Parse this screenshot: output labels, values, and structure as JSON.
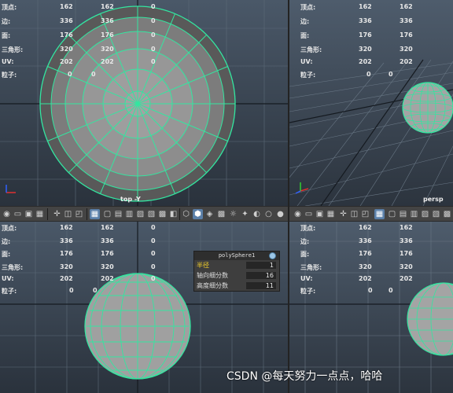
{
  "hud": {
    "rows": [
      {
        "label": "顶点:",
        "v1": "162",
        "v2": "162",
        "v3": "0"
      },
      {
        "label": "边:",
        "v1": "336",
        "v2": "336",
        "v3": "0"
      },
      {
        "label": "面:",
        "v1": "176",
        "v2": "176",
        "v3": "0"
      },
      {
        "label": "三角形:",
        "v1": "320",
        "v2": "320",
        "v3": "0"
      },
      {
        "label": "UV:",
        "v1": "202",
        "v2": "202",
        "v3": "0"
      },
      {
        "label": "粒子:",
        "v1": "0",
        "v2": "0",
        "v3": ""
      }
    ]
  },
  "viewports": {
    "top": {
      "camera": "top -Y"
    },
    "persp": {
      "camera": "persp"
    }
  },
  "poly_panel": {
    "title": "polySphere1",
    "rows": [
      {
        "label": "半径",
        "value": "1"
      },
      {
        "label": "轴向细分数",
        "value": "16"
      },
      {
        "label": "高度细分数",
        "value": "11"
      }
    ]
  },
  "watermark": "CSDN @每天努力一点点，哈哈",
  "colors": {
    "wireframe": "#33e6a0",
    "selected_label": "#f5d12a",
    "sphere_fill": "#a8a8a8",
    "highlight_icon": "#5a7fa8"
  },
  "toolbar_icons": [
    "camera-icon",
    "grid-icon",
    "wireframe-icon",
    "smooth-shade-icon",
    "textured-icon",
    "light-icon",
    "xray-icon",
    "isolate-icon"
  ]
}
